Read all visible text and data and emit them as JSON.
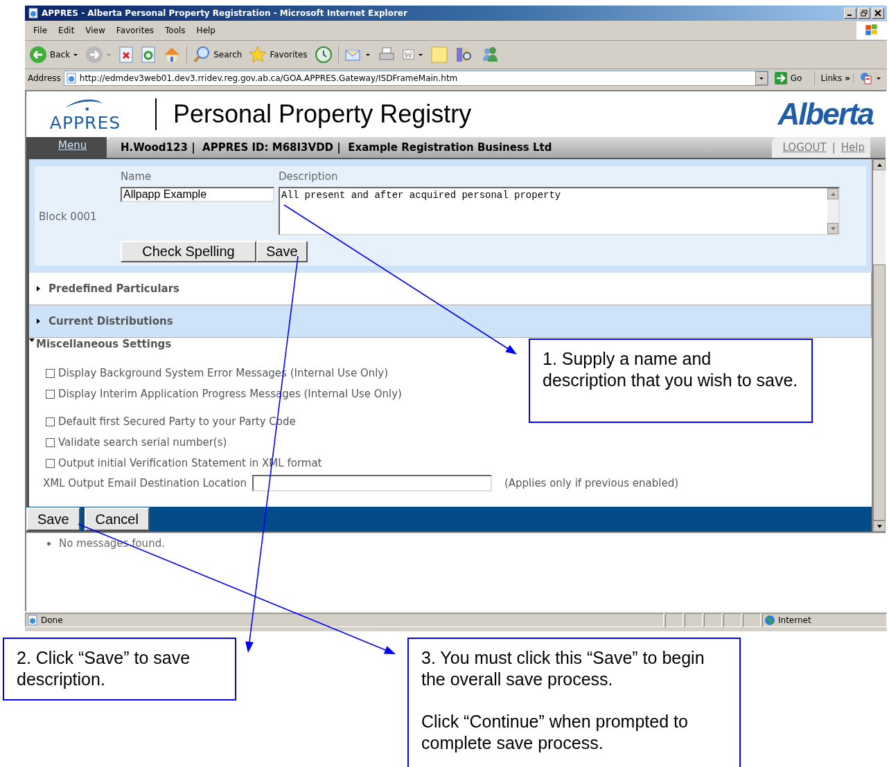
{
  "window": {
    "title": "APPRES - Alberta Personal Property Registration - Microsoft Internet Explorer"
  },
  "menu": [
    "File",
    "Edit",
    "View",
    "Favorites",
    "Tools",
    "Help"
  ],
  "toolbar": [
    {
      "kind": "back",
      "label": "Back"
    },
    {
      "kind": "forward"
    },
    {
      "kind": "stop"
    },
    {
      "kind": "refresh"
    },
    {
      "kind": "home"
    },
    {
      "kind": "search",
      "label": "Search"
    },
    {
      "kind": "favorites",
      "label": "Favorites"
    },
    {
      "kind": "history"
    },
    {
      "kind": "mail"
    },
    {
      "kind": "print"
    },
    {
      "kind": "edit"
    },
    {
      "kind": "note"
    },
    {
      "kind": "research"
    },
    {
      "kind": "messenger"
    }
  ],
  "address": {
    "label": "Address",
    "url": "http://edmdev3web01.dev3.rridev.reg.gov.ab.ca/GOA.APPRES.Gateway/ISDFrameMain.htm",
    "go": "Go",
    "links": "Links",
    "more": "»"
  },
  "header": {
    "logo": "APPRES",
    "title": "Personal Property Registry",
    "brand": "Alberta"
  },
  "nav": {
    "menu": "Menu",
    "user_info": "H.Wood123 |  APPRES ID: M68I3VDD |  Example Registration Business Ltd",
    "logout": "LOGOUT",
    "separator": "|",
    "help": "Help"
  },
  "block": {
    "label": "Block 0001",
    "name_label": "Name",
    "name_value": "Allpapp Example",
    "description_label": "Description",
    "description_value": "All present and after acquired personal property",
    "buttons": [
      "Check Spelling",
      "Save"
    ]
  },
  "sections": [
    {
      "title": "Predefined Particulars",
      "expanded": false,
      "highlighted": false
    },
    {
      "title": "Current Distributions",
      "expanded": false,
      "highlighted": true
    },
    {
      "title": "Miscellaneous Settings",
      "expanded": true,
      "highlighted": false
    }
  ],
  "settings": [
    [
      {
        "label": "Display Background System Error Messages (Internal Use Only)",
        "checked": false
      },
      {
        "label": "Display Interim Application Progress Messages (Internal Use Only)",
        "checked": false
      }
    ],
    [
      {
        "label": "Default first Secured Party to your Party Code",
        "checked": false
      },
      {
        "label": "Validate search serial number(s)",
        "checked": false
      },
      {
        "label": "Output initial Verification Statement in XML format",
        "checked": false
      }
    ]
  ],
  "xml_field": {
    "label": "XML Output Email Destination Location",
    "note": "(Applies only if previous enabled)"
  },
  "footer_buttons": [
    "Save",
    "Cancel"
  ],
  "messages": [
    "No messages found."
  ],
  "status_bar": {
    "text": "Done",
    "zone": "Internet"
  },
  "callouts": [
    {
      "paragraphs": [
        "1. Supply a name and description that you wish to save."
      ]
    },
    {
      "paragraphs": [
        "2. Click “Save” to save description."
      ]
    },
    {
      "paragraphs": [
        "3. You must click this “Save” to begin the overall save process.",
        "Click “Continue” when prompted to complete save process."
      ]
    }
  ]
}
